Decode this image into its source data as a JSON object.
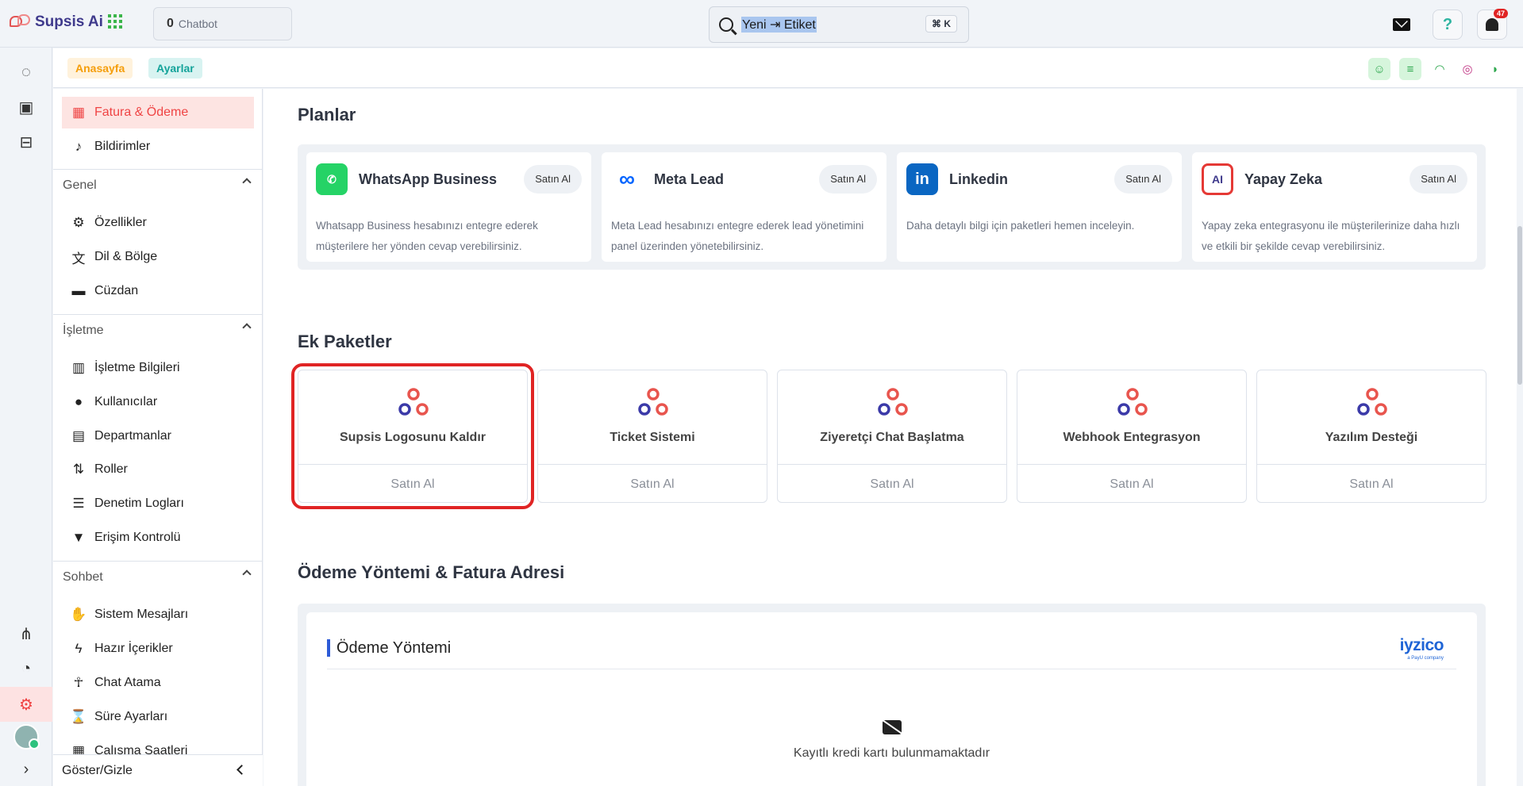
{
  "app": {
    "name": "Supsis Ai"
  },
  "topbar": {
    "chatbot_count": "0",
    "chatbot_label": "Chatbot",
    "search_value": "Yeni ⇥ Etiket",
    "search_shortcut": "⌘ K",
    "notification_count": "47"
  },
  "breadcrumb": {
    "home": "Anasayfa",
    "current": "Ayarlar"
  },
  "sidebar": {
    "top_items": [
      {
        "label": "Fatura & Ödeme",
        "icon": "store-icon",
        "active": true
      },
      {
        "label": "Bildirimler",
        "icon": "bell-icon"
      }
    ],
    "groups": [
      {
        "title": "Genel",
        "items": [
          {
            "label": "Özellikler",
            "icon": "gear-icon"
          },
          {
            "label": "Dil & Bölge",
            "icon": "translate-icon"
          },
          {
            "label": "Cüzdan",
            "icon": "wallet-icon"
          }
        ]
      },
      {
        "title": "İşletme",
        "items": [
          {
            "label": "İşletme Bilgileri",
            "icon": "building-icon"
          },
          {
            "label": "Kullanıcılar",
            "icon": "users-icon"
          },
          {
            "label": "Departmanlar",
            "icon": "departments-icon"
          },
          {
            "label": "Roller",
            "icon": "roles-icon"
          },
          {
            "label": "Denetim Logları",
            "icon": "list-icon"
          },
          {
            "label": "Erişim Kontrolü",
            "icon": "access-icon"
          }
        ]
      },
      {
        "title": "Sohbet",
        "items": [
          {
            "label": "Sistem Mesajları",
            "icon": "wave-icon"
          },
          {
            "label": "Hazır İçerikler",
            "icon": "bolt-icon"
          },
          {
            "label": "Chat Atama",
            "icon": "person-icon"
          },
          {
            "label": "Süre Ayarları",
            "icon": "hourglass-icon"
          },
          {
            "label": "Çalışma Saatleri",
            "icon": "calendar-icon"
          }
        ]
      }
    ],
    "footer_label": "Göster/Gizle"
  },
  "plans": {
    "title": "Planlar",
    "items": [
      {
        "name": "WhatsApp Business",
        "button": "Satın Al",
        "description": "Whatsapp Business hesabınızı entegre ederek müşterilere her yönden cevap verebilirsiniz.",
        "icon": "whatsapp-icon",
        "color": "#25d366"
      },
      {
        "name": "Meta Lead",
        "button": "Satın Al",
        "description": "Meta Lead hesabınızı entegre ederek lead yönetimini panel üzerinden yönetebilirsiniz.",
        "icon": "meta-icon",
        "color": "#0866ff"
      },
      {
        "name": "Linkedin",
        "button": "Satın Al",
        "description": "Daha detaylı bilgi için paketleri hemen inceleyin.",
        "icon": "linkedin-icon",
        "color": "#0a66c2"
      },
      {
        "name": "Yapay Zeka",
        "button": "Satın Al",
        "description": "Yapay zeka entegrasyonu ile müşterilerinize daha hızlı ve etkili bir şekilde cevap verebilirsiniz.",
        "icon": "ai-chip-icon",
        "color": "#e53935"
      }
    ]
  },
  "packages": {
    "title": "Ek Paketler",
    "items": [
      {
        "name": "Supsis Logosunu Kaldır",
        "button": "Satın Al",
        "selected": true
      },
      {
        "name": "Ticket Sistemi",
        "button": "Satın Al"
      },
      {
        "name": "Ziyeretçi Chat Başlatma",
        "button": "Satın Al"
      },
      {
        "name": "Webhook Entegrasyon",
        "button": "Satın Al"
      },
      {
        "name": "Yazılım Desteği",
        "button": "Satın Al"
      }
    ]
  },
  "payment": {
    "section_title": "Ödeme Yöntemi & Fatura Adresi",
    "card_title": "Ödeme Yöntemi",
    "provider": "iyzico",
    "provider_sub": "a PayU company",
    "empty_text": "Kayıtlı kredi kartı bulunmamaktadır"
  }
}
